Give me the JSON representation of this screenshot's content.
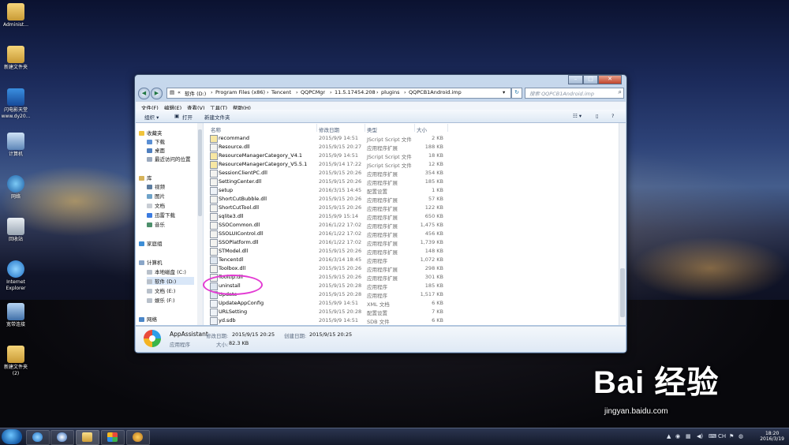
{
  "desktop": {
    "icons": [
      {
        "label": "Administ..."
      },
      {
        "label": "新建文件夹"
      },
      {
        "label": "闪电影天堂 www.dy20..."
      },
      {
        "label": "计算机"
      },
      {
        "label": "网络"
      },
      {
        "label": "回收站"
      },
      {
        "label": "Internet Explorer"
      },
      {
        "label": "宽带连接"
      },
      {
        "label": "新建文件夹 (2)"
      }
    ]
  },
  "window": {
    "controls": {
      "minimize": "–",
      "maximize": "□",
      "close": "✕"
    },
    "back": "◀",
    "forward": "▶",
    "breadcrumb": [
      "«",
      "软件 (D:)",
      "Program Files (x86)",
      "Tencent",
      "QQPCMgr",
      "11.5.17454.208",
      "plugins",
      "QQPCB1Android.imp"
    ],
    "search_placeholder": "搜索 QQPCB1Android.imp",
    "menu": [
      "文件(F)",
      "编辑(E)",
      "查看(V)",
      "工具(T)",
      "帮助(H)"
    ],
    "toolbar": {
      "organize": "组织 ▾",
      "open": "打开",
      "new_folder": "新建文件夹"
    },
    "nav": {
      "favorites": "收藏夹",
      "downloads": "下载",
      "desktop": "桌面",
      "recent": "最近访问的位置",
      "libraries": "库",
      "videos": "视频",
      "pictures": "图片",
      "documents": "文档",
      "thunder": "迅雷下载",
      "music": "音乐",
      "homegroup": "家庭组",
      "computer": "计算机",
      "drive_c": "本地磁盘 (C:)",
      "drive_d": "软件 (D:)",
      "drive_e": "文档 (E:)",
      "drive_f": "娱乐 (F:)",
      "network": "网络"
    },
    "columns": {
      "name": "名称",
      "modified": "修改日期",
      "type": "类型",
      "size": "大小"
    },
    "files": [
      {
        "name": "recommand",
        "modified": "2015/9/9 14:51",
        "type": "JScript Script 文件",
        "size": "2 KB",
        "icon": "js"
      },
      {
        "name": "Resource.dll",
        "modified": "2015/9/15 20:27",
        "type": "应用程序扩展",
        "size": "188 KB",
        "icon": "dll"
      },
      {
        "name": "ResourceManagerCategory_V4.1",
        "modified": "2015/9/9 14:51",
        "type": "JScript Script 文件",
        "size": "18 KB",
        "icon": "js"
      },
      {
        "name": "ResourceManagerCategory_V5.5.1",
        "modified": "2015/9/14 17:22",
        "type": "JScript Script 文件",
        "size": "12 KB",
        "icon": "js"
      },
      {
        "name": "SessionClientPC.dll",
        "modified": "2015/9/15 20:26",
        "type": "应用程序扩展",
        "size": "354 KB",
        "icon": "dll"
      },
      {
        "name": "SettingCenter.dll",
        "modified": "2015/9/15 20:26",
        "type": "应用程序扩展",
        "size": "185 KB",
        "icon": "dll"
      },
      {
        "name": "setup",
        "modified": "2016/3/15 14:45",
        "type": "配置设置",
        "size": "1 KB",
        "icon": "ini"
      },
      {
        "name": "ShortCutBubble.dll",
        "modified": "2015/9/15 20:26",
        "type": "应用程序扩展",
        "size": "57 KB",
        "icon": "dll"
      },
      {
        "name": "ShortCutTool.dll",
        "modified": "2015/9/15 20:26",
        "type": "应用程序扩展",
        "size": "122 KB",
        "icon": "dll"
      },
      {
        "name": "sqlite3.dll",
        "modified": "2015/9/9 15:14",
        "type": "应用程序扩展",
        "size": "650 KB",
        "icon": "dll"
      },
      {
        "name": "SSOCommon.dll",
        "modified": "2016/1/22 17:02",
        "type": "应用程序扩展",
        "size": "1,475 KB",
        "icon": "dll"
      },
      {
        "name": "SSOLUIControl.dll",
        "modified": "2016/1/22 17:02",
        "type": "应用程序扩展",
        "size": "456 KB",
        "icon": "dll"
      },
      {
        "name": "SSOPlatform.dll",
        "modified": "2016/1/22 17:02",
        "type": "应用程序扩展",
        "size": "1,739 KB",
        "icon": "dll"
      },
      {
        "name": "STModel.dll",
        "modified": "2015/9/15 20:26",
        "type": "应用程序扩展",
        "size": "148 KB",
        "icon": "dll"
      },
      {
        "name": "Tencentdl",
        "modified": "2016/3/14 18:45",
        "type": "应用程序",
        "size": "1,072 KB",
        "icon": "exe"
      },
      {
        "name": "Toolbox.dll",
        "modified": "2015/9/15 20:26",
        "type": "应用程序扩展",
        "size": "298 KB",
        "icon": "dll"
      },
      {
        "name": "Tooltip.dll",
        "modified": "2015/9/15 20:26",
        "type": "应用程序扩展",
        "size": "301 KB",
        "icon": "dll"
      },
      {
        "name": "uninstall",
        "modified": "2015/9/15 20:28",
        "type": "应用程序",
        "size": "185 KB",
        "icon": "exe"
      },
      {
        "name": "Update",
        "modified": "2015/9/15 20:28",
        "type": "应用程序",
        "size": "1,517 KB",
        "icon": "exe"
      },
      {
        "name": "UpdateAppConfig",
        "modified": "2015/9/9 14:51",
        "type": "XML 文档",
        "size": "6 KB",
        "icon": "xml"
      },
      {
        "name": "URLSetting",
        "modified": "2015/9/15 20:28",
        "type": "配置设置",
        "size": "7 KB",
        "icon": "ini"
      },
      {
        "name": "yd.sdb",
        "modified": "2015/9/9 14:51",
        "type": "SDB 文件",
        "size": "6 KB",
        "icon": "file"
      }
    ],
    "details": {
      "name": "AppAssistant",
      "type": "应用程序",
      "modified_label": "修改日期:",
      "modified": "2015/9/15 20:25",
      "created_label": "创建日期:",
      "created": "2015/9/15 20:25",
      "size_label": "大小:",
      "size": "82.3 KB"
    }
  },
  "taskbar": {
    "time": "18:20",
    "date": "2016/3/19",
    "ime": "CH"
  },
  "watermark": {
    "brand": "Bai 经验",
    "url": "jingyan.baidu.com"
  }
}
